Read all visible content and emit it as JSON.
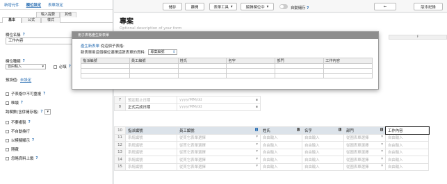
{
  "left_panel": {
    "top_tabs": [
      "新增元件",
      "欄位設定",
      "表單設定"
    ],
    "sub_tabs_row1": [
      "輸入提要",
      "其他"
    ],
    "sub_tabs_row2": [
      "基本",
      "公式",
      "樣式"
    ],
    "field_name_label": "欄位名稱",
    "field_name_value": "工作內容",
    "field_type_label": "欄位種類",
    "field_type_value": "自由輸入",
    "required_label": "必填",
    "default_label": "預設值:",
    "default_link": "未設定",
    "options": [
      {
        "label": "子表格中不可重複",
        "help": true
      },
      {
        "label": "唯讀",
        "help": true
      },
      {
        "label": "跨欄數(含併儲存格)",
        "help": true
      },
      {
        "label": "不要複製",
        "help": true
      },
      {
        "label": "不自動換行",
        "help": false
      },
      {
        "label": "以模擬顯示",
        "help": true
      },
      {
        "label": "隱藏",
        "help": false
      },
      {
        "label": "忽略資料上鎖",
        "help": true
      }
    ],
    "help_mark": "?"
  },
  "toolbar": {
    "save": "儲存",
    "cancel": "離開",
    "form_tools": "表單工具",
    "edit_field": "編輯欄位中",
    "auto_save": "自動儲存",
    "back": "←",
    "version": "版本紀錄"
  },
  "canvas": {
    "form_title": "專案",
    "form_desc": "Optional description of your form",
    "col_f": "F",
    "rows": [
      {
        "n": "7",
        "label": "預定截止日期",
        "value": "yyyy/MM/dd"
      },
      {
        "n": "8",
        "label": "正式完成日期",
        "value": "yyyy/MM/dd"
      }
    ],
    "subtable_header": {
      "n": "10",
      "cols": [
        "指派編號",
        "員工編號",
        "",
        "姓氏",
        "名字",
        "部門",
        "工作內容"
      ]
    },
    "subtable_rows": [
      {
        "n": "11",
        "c1": "系統編號",
        "c2": "從貫它表單選擇",
        "c3": "自由輸入",
        "c4": "自由輸入",
        "c5": "從圖表單選擇",
        "c6": "自由輸入"
      },
      {
        "n": "12",
        "c1": "系統編號",
        "c2": "從貫它表單選擇",
        "c3": "自由輸入",
        "c4": "自由輸入",
        "c5": "從圖表單選擇",
        "c6": "自由輸入"
      },
      {
        "n": "13",
        "c1": "系統編號",
        "c2": "從貫它表單選擇",
        "c3": "自由輸入",
        "c4": "自由輸入",
        "c5": "從圖表單選擇",
        "c6": "自由輸入"
      },
      {
        "n": "14",
        "c1": "系統編號",
        "c2": "從貫它表單選擇",
        "c3": "自由輸入",
        "c4": "自由輸入",
        "c5": "從圖表單選擇",
        "c6": "自由輸入"
      },
      {
        "n": "15",
        "c1": "系統編號",
        "c2": "從貫它表單選擇",
        "c3": "自由輸入",
        "c4": "自由輸入",
        "c5": "從圖表單選擇",
        "c6": "自由輸入"
      }
    ],
    "badges": [
      "L",
      "L",
      "L",
      "L"
    ]
  },
  "dialog": {
    "title": "用子表格產生新表單",
    "line1_link": "產生新表單",
    "line1_rest": "從這個子表格:",
    "line2": "新表單用這個欄位選擇這張表單的資料:",
    "select_value": "專案編號",
    "columns": [
      "指派編號",
      "員工編號",
      "姓氏",
      "名字",
      "部門",
      "工作內容"
    ]
  },
  "colors": {
    "accent": "#2b6fb3",
    "dialog_title_bg": "#8e8e8e",
    "header_cell_bg": "#dce3ea"
  }
}
